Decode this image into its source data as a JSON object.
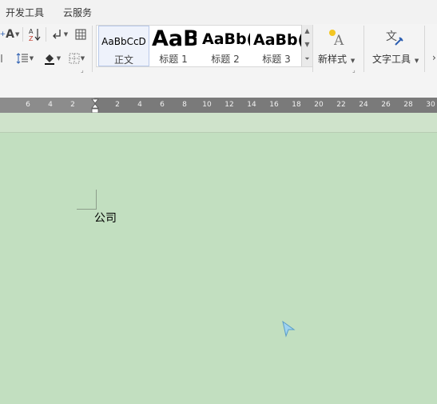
{
  "menu": {
    "items": [
      "开发工具",
      "云服务"
    ]
  },
  "ribbon": {
    "font_group": {
      "grow_font_label": "A",
      "sort_label": "A↓Z",
      "table_icon": "table-icon",
      "line_spacing_icon": "line-spacing-icon",
      "shading_icon": "paint-bucket-icon",
      "border_icon": "border-icon"
    },
    "styles": [
      {
        "sample": "AaBbCcD",
        "label": "正文"
      },
      {
        "sample": "AaB",
        "label": "标题 1"
      },
      {
        "sample": "AaBb(",
        "label": "标题 2"
      },
      {
        "sample": "AaBb(",
        "label": "标题 3"
      }
    ],
    "new_style": {
      "label": "新样式"
    },
    "text_tools": {
      "label": "文字工具"
    },
    "colors": {
      "accent_red": "#c0392b",
      "accent_blue": "#2a5db0"
    }
  },
  "ruler": {
    "left_ticks": [
      "6",
      "4",
      "2"
    ],
    "right_ticks": [
      "2",
      "4",
      "6",
      "8",
      "10",
      "12",
      "14",
      "16",
      "18",
      "20",
      "22",
      "24",
      "26",
      "28",
      "30"
    ]
  },
  "document": {
    "text": "公司",
    "background": "#c2dfc0"
  }
}
